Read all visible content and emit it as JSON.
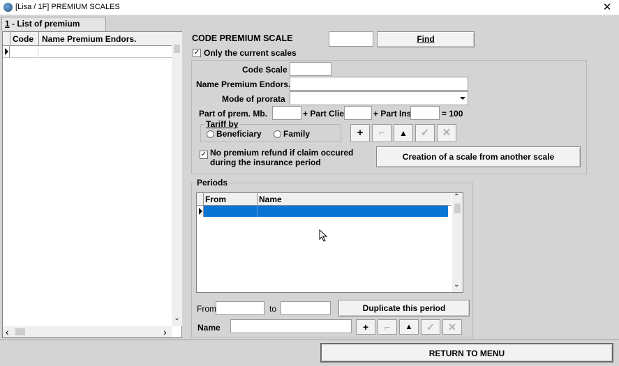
{
  "window": {
    "title": "[Lisa / 1F] PREMIUM SCALES",
    "close_label": "✕"
  },
  "tab": {
    "number": "1",
    "label": " - List of premium scales"
  },
  "list": {
    "columns": [
      "Code",
      "Name Premium Endors."
    ],
    "scroll_left": "‹",
    "scroll_right": "›",
    "scroll_down": "⌄"
  },
  "search": {
    "label": "CODE PREMIUM SCALE",
    "value": "",
    "find_label": "Find",
    "only_current_label": "Only the current scales",
    "only_current_checked": true
  },
  "form": {
    "code_scale_label": "Code Scale",
    "name_label": "Name Premium Endors.",
    "mode_label": "Mode of prorata",
    "part_prem_label": "Part of prem. Mb.",
    "part_clie_label": "+ Part Clie",
    "part_ins_label": "+ Part Ins",
    "equals_label": "= 100",
    "tariff_label": "Tariff by",
    "tariff_options": [
      "Beneficiary",
      "Family"
    ],
    "no_refund_label_1": "No premium refund if claim occured",
    "no_refund_label_2": "during the insurance period",
    "no_refund_checked": true,
    "creation_button": "Creation of a scale from another scale"
  },
  "nav_buttons": [
    "+",
    "⌐",
    "▲",
    "✓",
    "✕"
  ],
  "periods": {
    "title": "Periods",
    "columns": [
      "From",
      "Name"
    ],
    "from_label": "From",
    "to_label": "to",
    "duplicate_button": "Duplicate this period",
    "name_label": "Name"
  },
  "return_button": "RETURN TO MENU",
  "colors": {
    "selection": "#0a74d4",
    "background": "#d4d4d4"
  }
}
